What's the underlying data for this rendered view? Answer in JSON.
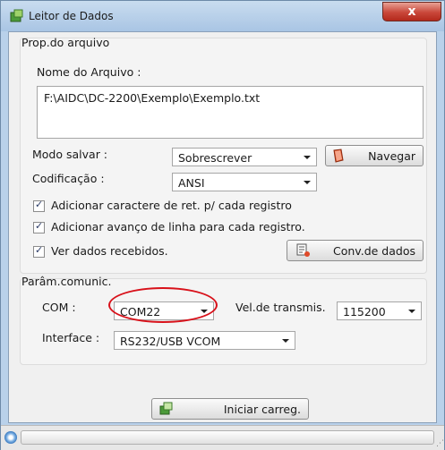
{
  "window": {
    "title": "Leitor de Dados",
    "close_label": "x"
  },
  "file_group": {
    "title": "Prop.do arquivo",
    "filename_label": "Nome do Arquivo :",
    "filename_value": "F:\\AIDC\\DC-2200\\Exemplo\\Exemplo.txt",
    "save_mode_label": "Modo salvar :",
    "save_mode_value": "Sobrescrever",
    "browse_label": "Navegar",
    "encoding_label": "Codificação :",
    "encoding_value": "ANSI",
    "opt_carriage_return": "Adicionar caractere de ret. p/ cada registro",
    "opt_line_feed": "Adicionar avanço de linha para cada registro.",
    "opt_view_data": "Ver dados recebidos.",
    "convert_label": "Conv.de dados"
  },
  "comm_group": {
    "title": "Parâm.comunic.",
    "com_label": "COM :",
    "com_value": "COM22",
    "baud_label": "Vel.de transmis.",
    "baud_value": "115200",
    "interface_label": "Interface :",
    "interface_value": "RS232/USB VCOM"
  },
  "actions": {
    "start_label": "Iniciar carreg."
  },
  "colors": {
    "highlight_ring": "#d8111a",
    "close_button": "#c9473a"
  },
  "icons": {
    "app": "app-icon",
    "browse": "folder-icon",
    "convert": "convert-icon",
    "start": "upload-icon",
    "status": "status-icon"
  }
}
